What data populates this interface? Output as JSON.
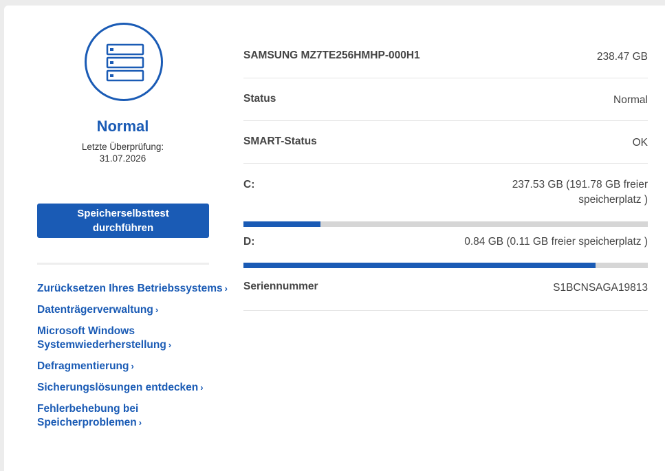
{
  "status": {
    "icon": "storage-drive-icon",
    "title": "Normal",
    "last_check_label": "Letzte Überprüfung:",
    "last_check_date": "31.07.2026"
  },
  "selftest_button": "Speicherselbsttest\ndurchführen",
  "links": [
    {
      "label": "Zurücksetzen Ihres Betriebssystems",
      "chevron": "›"
    },
    {
      "label": "Datenträgerverwaltung",
      "chevron": "›"
    },
    {
      "label": "Microsoft Windows Systemwiederherstellung",
      "chevron": "›"
    },
    {
      "label": "Defragmentierung",
      "chevron": "›"
    },
    {
      "label": "Sicherungslösungen entdecken",
      "chevron": "›"
    },
    {
      "label": "Fehlerbehebung bei Speicherproblemen",
      "chevron": "›"
    }
  ],
  "drive": {
    "model": "SAMSUNG MZ7TE256HMHP-000H1",
    "capacity": "238.47 GB",
    "status_label": "Status",
    "status_value": "Normal",
    "smart_label": "SMART-Status",
    "smart_value": "OK",
    "serial_label": "Seriennummer",
    "serial_value": "S1BCNSAGA19813"
  },
  "partitions": [
    {
      "label": "C:",
      "value": "237.53 GB (191.78 GB freier speicherplatz )",
      "used_percent": 19
    },
    {
      "label": "D:",
      "value": "0.84 GB (0.11 GB freier speicherplatz )",
      "used_percent": 87
    }
  ],
  "colors": {
    "accent": "#1a5bb5",
    "bar_track": "#d6d6d6"
  }
}
